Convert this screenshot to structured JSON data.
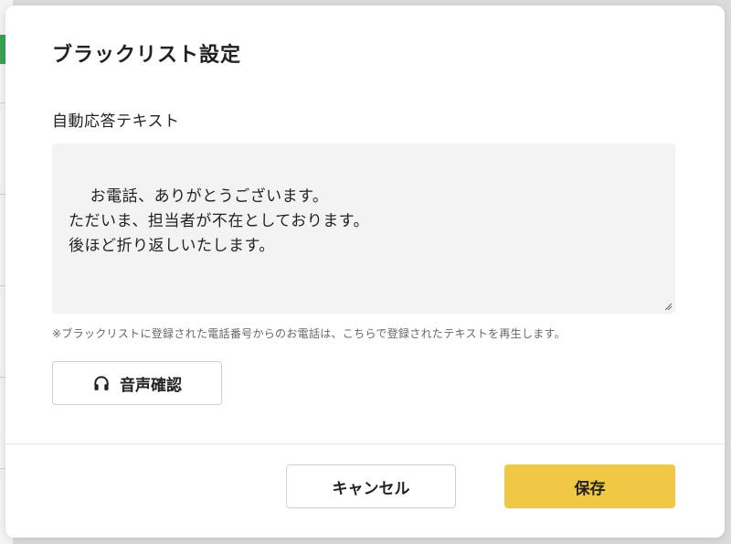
{
  "dialog": {
    "title": "ブラックリスト設定",
    "field_label": "自動応答テキスト",
    "auto_reply_text": "お電話、ありがとうございます。\nただいま、担当者が不在としております。\n後ほど折り返しいたします。",
    "note": "※ブラックリストに登録された電話番号からのお電話は、こちらで登録されたテキストを再生します。",
    "audio_check_label": "音声確認",
    "audio_check_icon": "headphones-icon",
    "cancel_label": "キャンセル",
    "save_label": "保存"
  },
  "colors": {
    "save_button": "#f0c843",
    "textarea_bg": "#f3f3f3",
    "background_accent": "#3aa35a"
  }
}
